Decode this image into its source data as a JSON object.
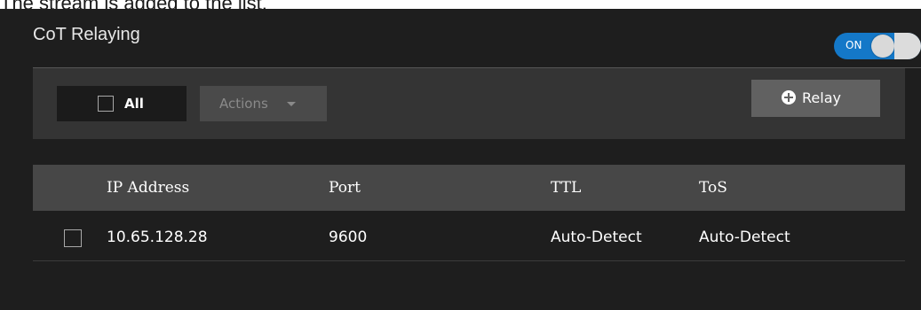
{
  "caption": "The stream is added to the list.",
  "panel": {
    "title": "CoT Relaying",
    "toggle": {
      "label": "ON",
      "state": "on",
      "color": "#1478c8"
    }
  },
  "toolbar": {
    "select_all_label": "All",
    "actions_label": "Actions",
    "relay_label": "Relay"
  },
  "table": {
    "columns": [
      "IP Address",
      "Port",
      "TTL",
      "ToS"
    ],
    "rows": [
      {
        "ip": "10.65.128.28",
        "port": "9600",
        "ttl": "Auto-Detect",
        "tos": "Auto-Detect",
        "checked": false
      }
    ]
  }
}
